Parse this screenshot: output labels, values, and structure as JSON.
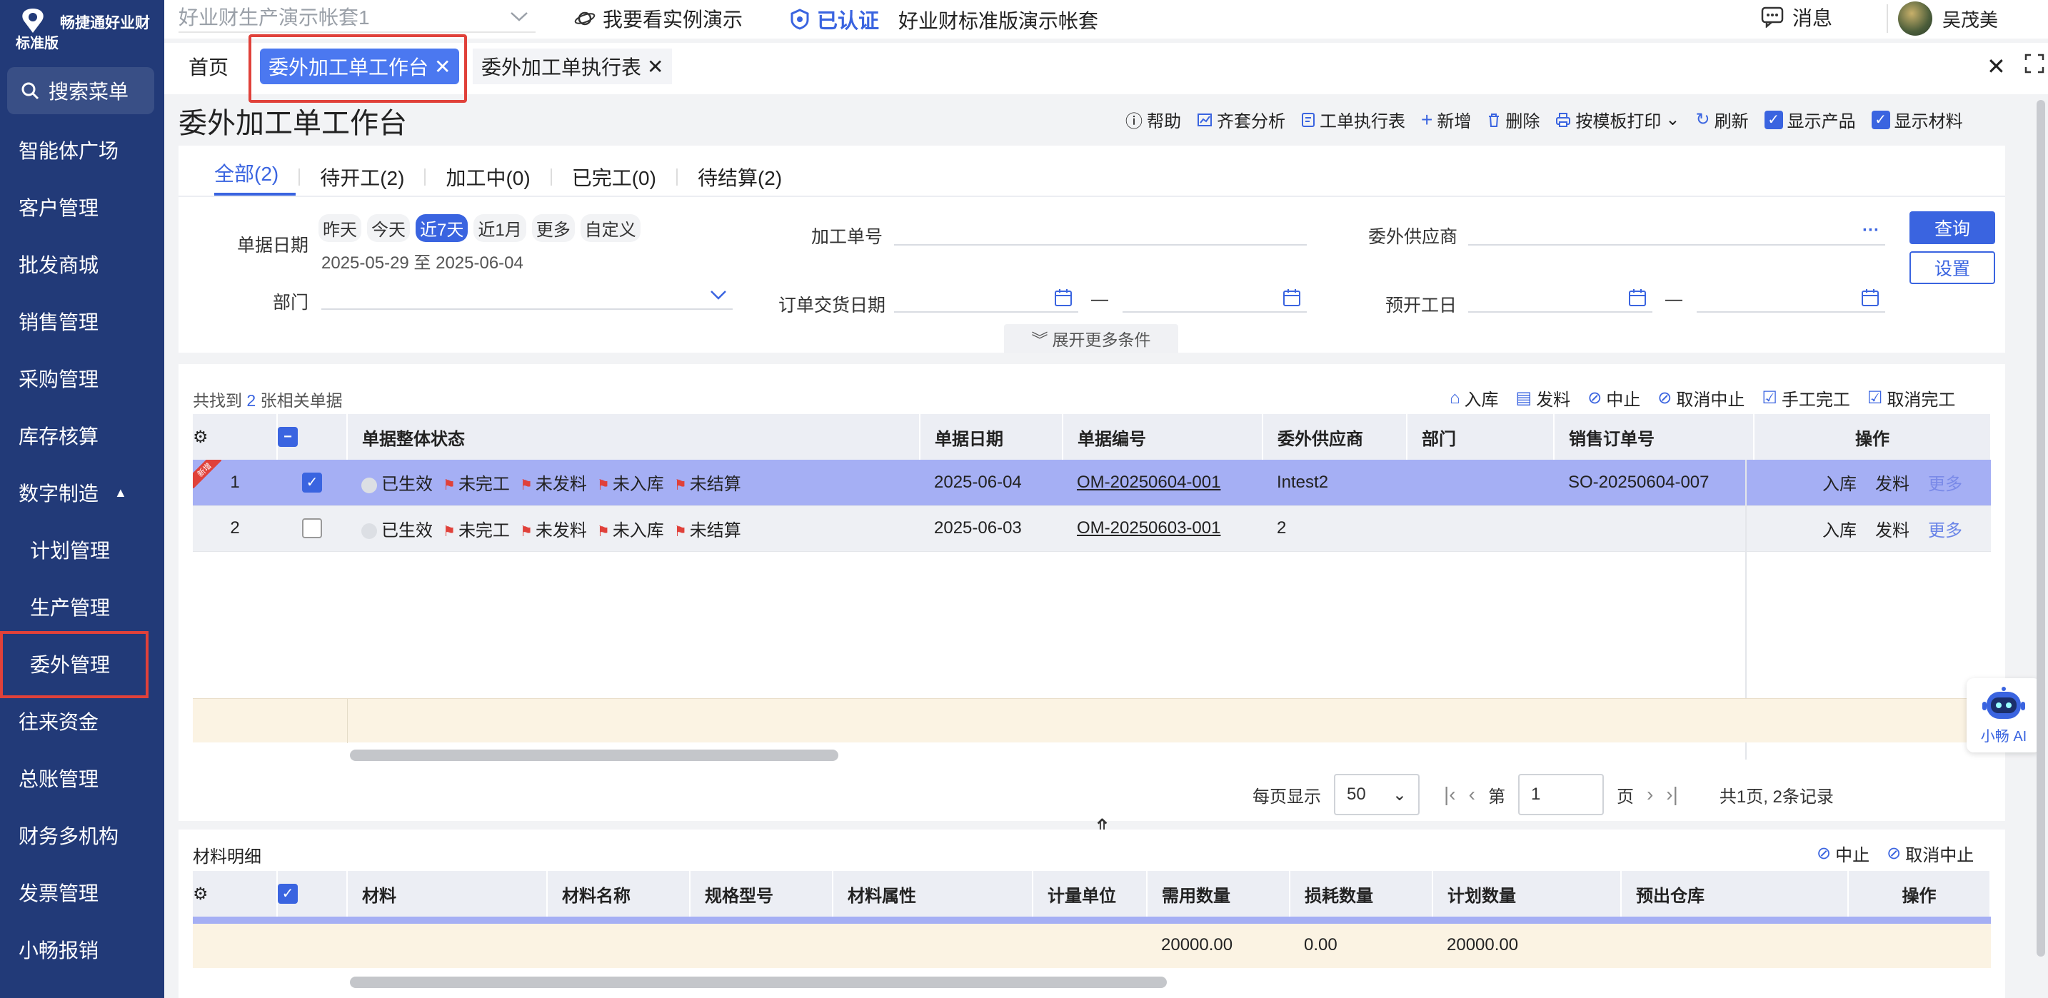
{
  "brand": {
    "name": "畅捷通好业财",
    "edition": "标准版"
  },
  "sidebar": {
    "search_label": "搜索菜单",
    "items": [
      {
        "label": "智能体广场"
      },
      {
        "label": "客户管理"
      },
      {
        "label": "批发商城"
      },
      {
        "label": "销售管理"
      },
      {
        "label": "采购管理"
      },
      {
        "label": "库存核算"
      },
      {
        "label": "数字制造"
      },
      {
        "label": "计划管理"
      },
      {
        "label": "生产管理"
      },
      {
        "label": "委外管理"
      },
      {
        "label": "往来资金"
      },
      {
        "label": "总账管理"
      },
      {
        "label": "财务多机构"
      },
      {
        "label": "发票管理"
      },
      {
        "label": "小畅报销"
      }
    ]
  },
  "topbar": {
    "account": "好业财生产演示帐套1",
    "demo_link": "我要看实例演示",
    "cert": "已认证",
    "std_account": "好业财标准版演示帐套",
    "messages": "消息",
    "user": "吴茂美"
  },
  "tabs": [
    {
      "label": "首页"
    },
    {
      "label": "委外加工单工作台"
    },
    {
      "label": "委外加工单执行表"
    }
  ],
  "page": {
    "title": "委外加工单工作台",
    "toolbar": {
      "help": "帮助",
      "kit_analysis": "齐套分析",
      "exec_table": "工单执行表",
      "add": "新增",
      "delete": "删除",
      "print": "按模板打印",
      "refresh": "刷新",
      "show_product": "显示产品",
      "show_material": "显示材料"
    }
  },
  "status_tabs": [
    {
      "label": "全部(2)"
    },
    {
      "label": "待开工(2)"
    },
    {
      "label": "加工中(0)"
    },
    {
      "label": "已完工(0)"
    },
    {
      "label": "待结算(2)"
    }
  ],
  "filters": {
    "doc_date_label": "单据日期",
    "date_chips": [
      "昨天",
      "今天",
      "近7天",
      "近1月",
      "更多",
      "自定义"
    ],
    "date_range": "2025-05-29 至 2025-06-04",
    "order_no_label": "加工单号",
    "supplier_label": "委外供应商",
    "dept_label": "部门",
    "delivery_label": "订单交货日期",
    "start_label": "预开工日",
    "dash": "—",
    "query": "查询",
    "settings": "设置",
    "expand": "展开更多条件"
  },
  "list": {
    "found_prefix": "共找到",
    "found_count": "2",
    "found_suffix": "张相关单据",
    "actions": [
      "入库",
      "发料",
      "中止",
      "取消中止",
      "手工完工",
      "取消完工"
    ],
    "columns": [
      "单据整体状态",
      "单据日期",
      "单据编号",
      "委外供应商",
      "部门",
      "销售订单号",
      "操作"
    ],
    "rows": [
      {
        "no": "1",
        "status": "已生效",
        "s1": "未完工",
        "s2": "未发料",
        "s3": "未入库",
        "s4": "未结算",
        "date": "2025-06-04",
        "code": "OM-20250604-001",
        "supplier": "Intest2",
        "dept": "",
        "so": "SO-20250604-007",
        "op1": "入库",
        "op2": "发料",
        "op3": "更多",
        "ribbon": "新增"
      },
      {
        "no": "2",
        "status": "已生效",
        "s1": "未完工",
        "s2": "未发料",
        "s3": "未入库",
        "s4": "未结算",
        "date": "2025-06-03",
        "code": "OM-20250603-001",
        "supplier": "2",
        "dept": "",
        "so": "",
        "op1": "入库",
        "op2": "发料",
        "op3": "更多"
      }
    ],
    "pager": {
      "per_page_label": "每页显示",
      "per_page": "50",
      "page_prefix": "第",
      "page": "1",
      "page_suffix": "页",
      "total": "共1页, 2条记录"
    }
  },
  "materials": {
    "title": "材料明细",
    "actions": [
      "中止",
      "取消中止"
    ],
    "columns": [
      "材料",
      "材料名称",
      "规格型号",
      "材料属性",
      "计量单位",
      "需用数量",
      "损耗数量",
      "计划数量",
      "预出仓库",
      "操作"
    ],
    "totals": {
      "required": "20000.00",
      "loss": "0.00",
      "planned": "20000.00"
    }
  },
  "ai": {
    "label": "小畅 AI"
  },
  "colors": {
    "sidebar": "#223a78",
    "accent": "#3a64e0",
    "selected_row": "#a5aff4",
    "highlight_box": "#e0413a"
  }
}
